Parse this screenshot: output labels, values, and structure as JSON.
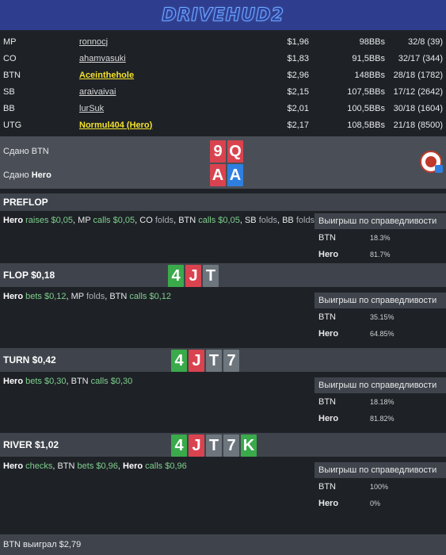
{
  "header": {
    "logo_text": "DRIVEHUD2"
  },
  "players": [
    {
      "position": "MP",
      "name": "ronnocj",
      "stack": "$1,96",
      "bb": "98BBs",
      "record": "32/8 (39)",
      "highlight": false
    },
    {
      "position": "CO",
      "name": "ahamvasuki",
      "stack": "$1,83",
      "bb": "91,5BBs",
      "record": "32/17 (344)",
      "highlight": false
    },
    {
      "position": "BTN",
      "name": "Aceinthehole",
      "stack": "$2,96",
      "bb": "148BBs",
      "record": "28/18 (1782)",
      "highlight": true
    },
    {
      "position": "SB",
      "name": "araivaivai",
      "stack": "$2,15",
      "bb": "107,5BBs",
      "record": "17/12 (2642)",
      "highlight": false
    },
    {
      "position": "BB",
      "name": "lurSuk",
      "stack": "$2,01",
      "bb": "100,5BBs",
      "record": "30/18 (1604)",
      "highlight": false
    },
    {
      "position": "UTG",
      "name": "Normul404 (Hero)",
      "stack": "$2,17",
      "bb": "108,5BBs",
      "record": "21/18 (8500)",
      "highlight": true
    }
  ],
  "dealt": {
    "btn_label": "Сдано BTN",
    "hero_prefix": "Сдано ",
    "hero_name": "Hero",
    "btn_cards": [
      {
        "rank": "9",
        "color": "#d9434f"
      },
      {
        "rank": "Q",
        "color": "#d9434f"
      }
    ],
    "hero_cards": [
      {
        "rank": "A",
        "color": "#d9434f"
      },
      {
        "rank": "A",
        "color": "#2f7fe0"
      }
    ]
  },
  "equity_title": "Выигрыш по справедливости",
  "streets": {
    "preflop": {
      "title": "PREFLOP",
      "a1": "Hero",
      "a2": " raises $0,05",
      ", ": ", ",
      "a3": "MP",
      "a4": " calls $0,05",
      "a5": ", ",
      "a6": "CO",
      "a7": " folds",
      "a8": ", ",
      "a9": "BTN",
      "a10": " calls $0,05",
      "a11": ", ",
      "a12": "SB",
      "a13": " folds",
      "a14": ", ",
      "a15": "BB",
      "a16": " folds",
      "eq": [
        {
          "player": "BTN",
          "value": "18.3%"
        },
        {
          "player": "Hero",
          "value": "81.7%"
        }
      ]
    },
    "flop": {
      "title": "FLOP  $0,18",
      "cards": [
        {
          "rank": "4",
          "color": "#3aaa4b"
        },
        {
          "rank": "J",
          "color": "#d9434f"
        },
        {
          "rank": "T",
          "color": "#6d757d"
        }
      ],
      "a1": "Hero",
      "a2": " bets $0,12",
      "a3": ", MP ",
      "a4": "folds",
      "a5": ", BTN ",
      "a6": "calls $0,12",
      "eq": [
        {
          "player": "BTN",
          "value": "35.15%"
        },
        {
          "player": "Hero",
          "value": "64.85%"
        }
      ]
    },
    "turn": {
      "title": "TURN  $0,42",
      "cards": [
        {
          "rank": "4",
          "color": "#3aaa4b"
        },
        {
          "rank": "J",
          "color": "#d9434f"
        },
        {
          "rank": "T",
          "color": "#6d757d"
        },
        {
          "rank": "7",
          "color": "#6d757d"
        }
      ],
      "a1": "Hero",
      "a2": " bets $0,30",
      "a3": ", BTN ",
      "a4": "calls $0,30",
      "eq": [
        {
          "player": "BTN",
          "value": "18.18%"
        },
        {
          "player": "Hero",
          "value": "81.82%"
        }
      ]
    },
    "river": {
      "title": "RIVER  $1,02",
      "cards": [
        {
          "rank": "4",
          "color": "#3aaa4b"
        },
        {
          "rank": "J",
          "color": "#d9434f"
        },
        {
          "rank": "T",
          "color": "#6d757d"
        },
        {
          "rank": "7",
          "color": "#6d757d"
        },
        {
          "rank": "K",
          "color": "#3aaa4b"
        }
      ],
      "a1": "Hero",
      "a2": " checks",
      "a3": ", BTN ",
      "a4": "bets $0,96",
      "a5": ", ",
      "a6": "Hero",
      "a7": " calls $0,96",
      "eq": [
        {
          "player": "BTN",
          "value": "100%"
        },
        {
          "player": "Hero",
          "value": "0%"
        }
      ]
    }
  },
  "footer": {
    "result": "BTN выиграл $2,79"
  },
  "colors": {
    "background": "#1e2227",
    "header": "#2f3d8f",
    "section": "#3f444c",
    "highlight": "#f4e32a",
    "action_green": "#7fcf8c",
    "action_grey": "#a9adb3"
  }
}
